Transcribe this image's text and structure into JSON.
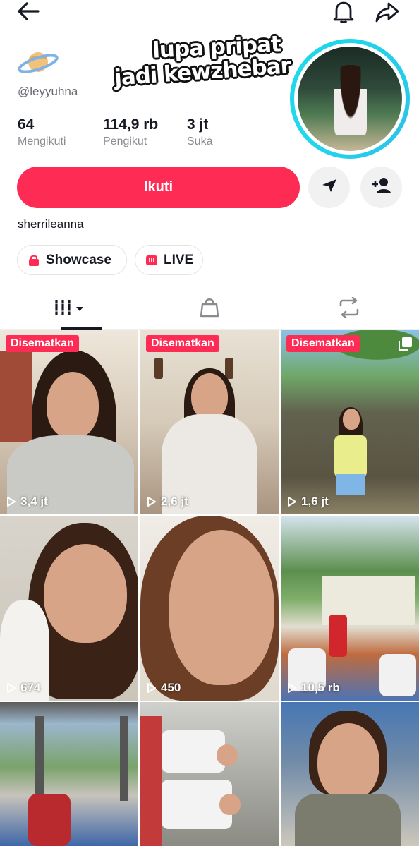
{
  "topbar": {
    "back_icon": "arrow-left-icon",
    "bell_icon": "bell-icon",
    "share_icon": "share-arrow-icon"
  },
  "profile": {
    "username": "@leyyuhna",
    "overlay_line1": "lupa pripat",
    "overlay_line2": "jadi kewzhebar",
    "bio": "sherrileanna",
    "story_ring_color": "#1ed6e9"
  },
  "stats": [
    {
      "value": "64",
      "label": "Mengikuti"
    },
    {
      "value": "114,9 rb",
      "label": "Pengikut"
    },
    {
      "value": "3 jt",
      "label": "Suka"
    }
  ],
  "actions": {
    "follow_label": "Ikuti",
    "follow_color": "#fe2c55"
  },
  "pills": {
    "showcase_label": "Showcase",
    "live_label": "LIVE"
  },
  "tabs": [
    {
      "icon": "grid-videos-icon",
      "active": true
    },
    {
      "icon": "shopping-bag-icon",
      "active": false
    },
    {
      "icon": "repost-icon",
      "active": false
    }
  ],
  "videos": [
    {
      "pinned": "Disematkan",
      "views": "3,4 jt"
    },
    {
      "pinned": "Disematkan",
      "views": "2,6 jt"
    },
    {
      "pinned": "Disematkan",
      "views": "1,6 jt"
    },
    {
      "pinned": "",
      "views": "674"
    },
    {
      "pinned": "",
      "views": "450"
    },
    {
      "pinned": "",
      "views": "10,5 rb"
    },
    {
      "pinned": "",
      "views": ""
    },
    {
      "pinned": "",
      "views": ""
    },
    {
      "pinned": "",
      "views": ""
    }
  ]
}
